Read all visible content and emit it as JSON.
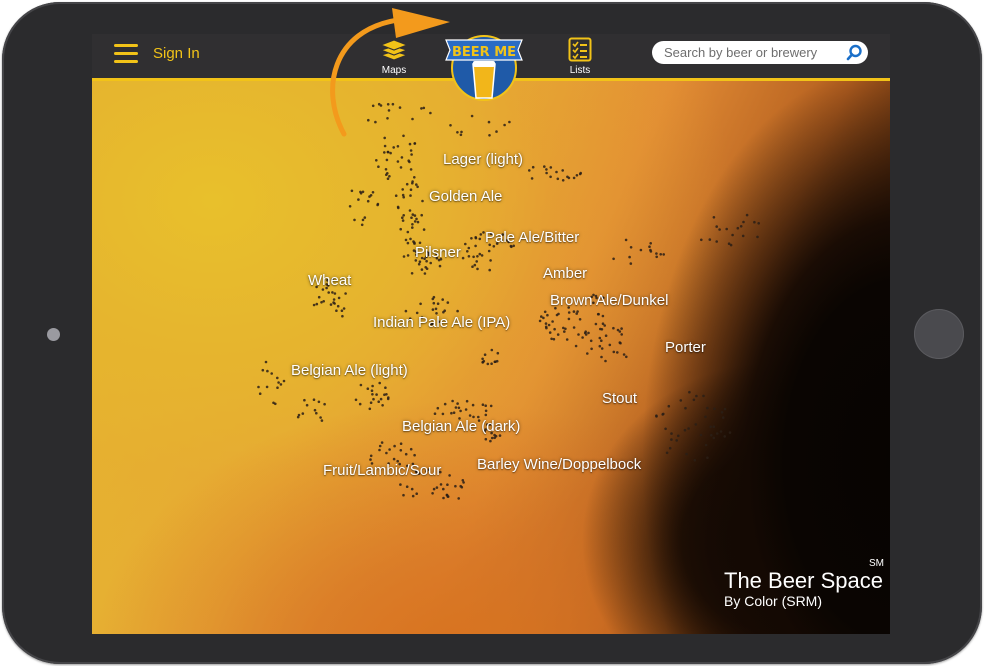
{
  "header": {
    "signin_label": "Sign In",
    "maps_label": "Maps",
    "lists_label": "Lists",
    "logo_text": "BEER ME",
    "search_placeholder": "Search by beer or brewery"
  },
  "map": {
    "styles": [
      "Lager (light)",
      "Golden Ale",
      "Pale Ale/Bitter",
      "Pilsner",
      "Amber",
      "Wheat",
      "Brown Ale/Dunkel",
      "Indian Pale Ale (IPA)",
      "Porter",
      "Belgian Ale (light)",
      "Stout",
      "Belgian Ale (dark)",
      "Fruit/Lambic/Sour",
      "Barley Wine/Doppelbock"
    ],
    "brand_title": "The Beer Space",
    "brand_mark": "SM",
    "brand_subtitle": "By Color (SRM)"
  },
  "colors": {
    "accent": "#f2c318",
    "bezel": "#2b2b2d",
    "topbar": "#302f31",
    "arrow": "#f39a1c"
  },
  "icons": [
    "menu-icon",
    "maps-stack-icon",
    "lists-checklist-icon",
    "beer-me-logo",
    "search-icon",
    "orange-curved-arrow"
  ]
}
